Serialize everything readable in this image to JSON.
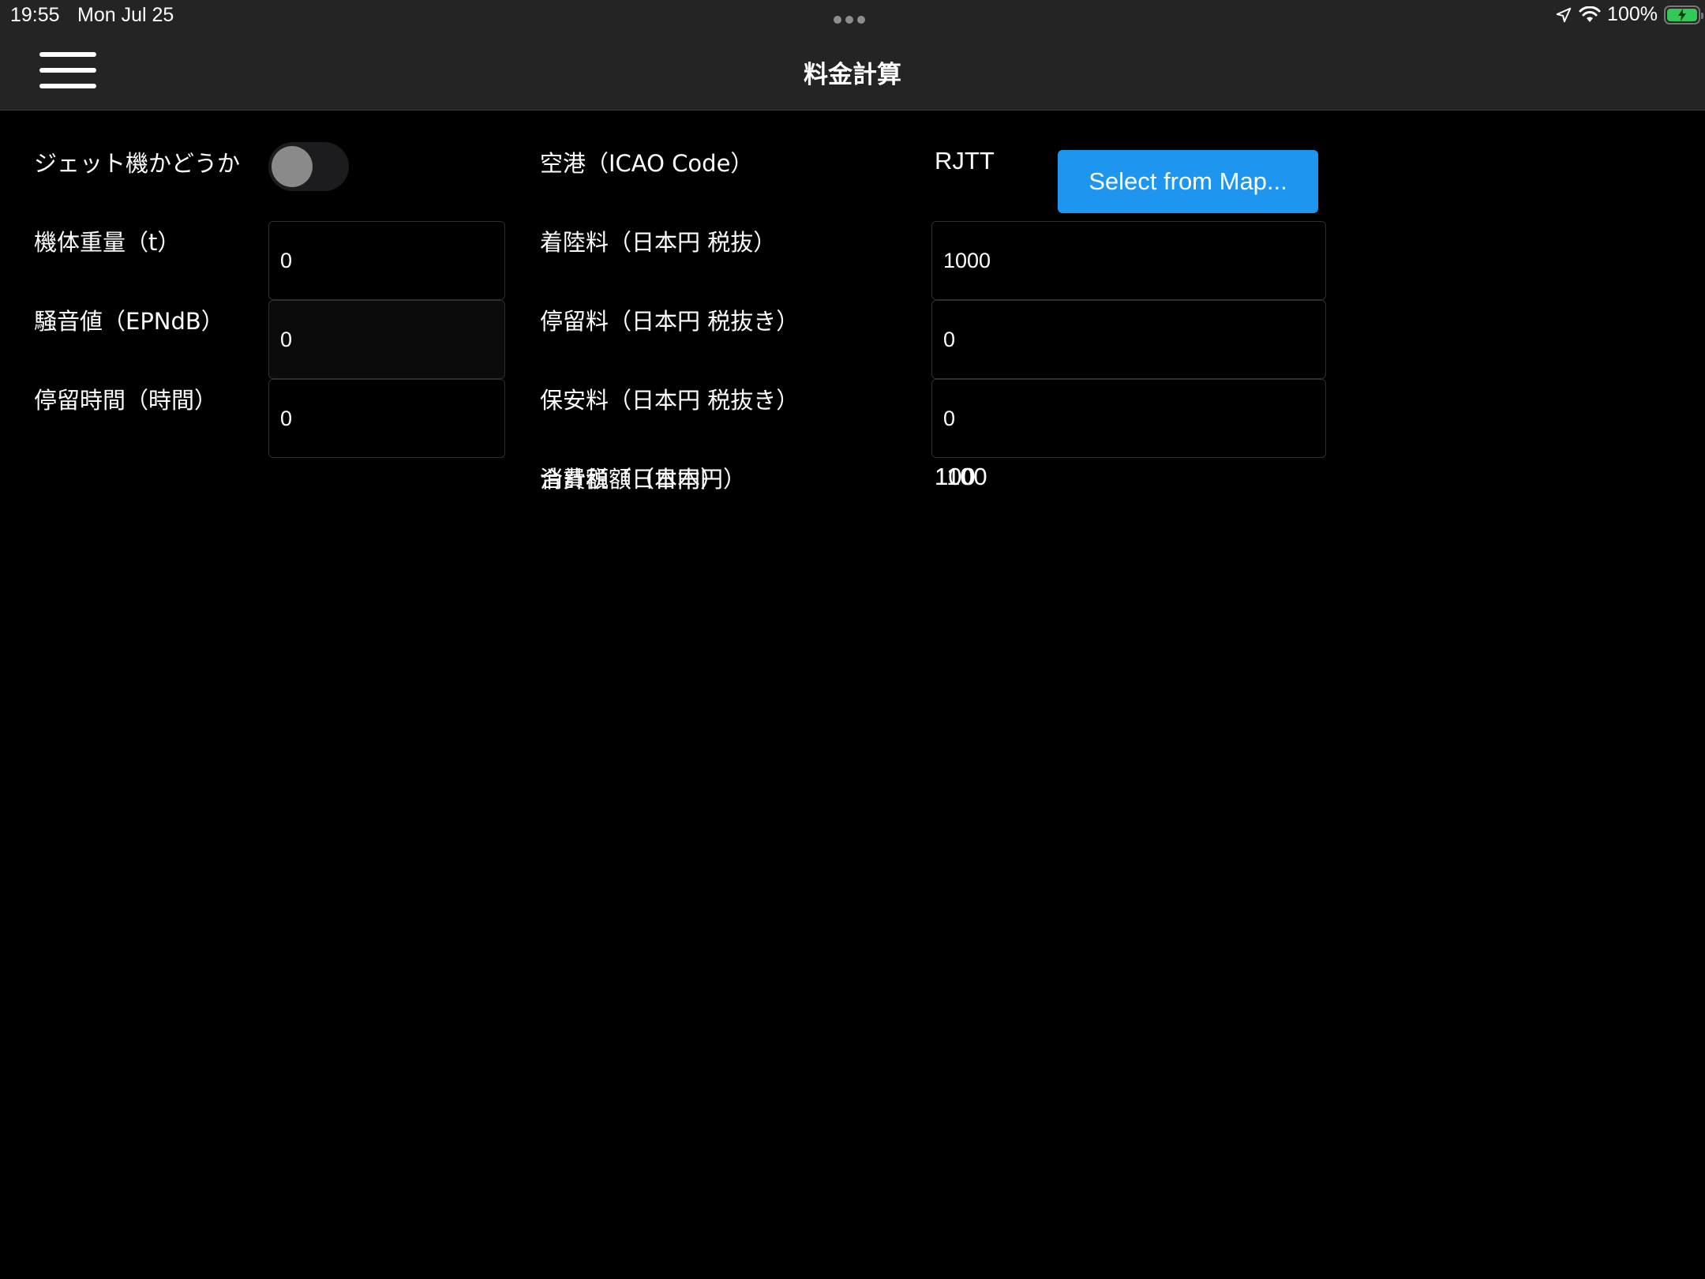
{
  "status_bar": {
    "time": "19:55",
    "date": "Mon Jul 25",
    "battery": "100%"
  },
  "nav": {
    "title": "料金計算"
  },
  "left": {
    "jet_label": "ジェット機かどうか",
    "jet_toggle_on": false,
    "weight_label": "機体重量（t）",
    "weight_value": "0",
    "noise_label": "騒音値（EPNdB）",
    "noise_value": "0",
    "stay_hours_label": "停留時間（時間）",
    "stay_hours_value": "0"
  },
  "right": {
    "airport_label": "空港（ICAO Code）",
    "airport_value": "RJTT",
    "map_button": "Select from Map...",
    "landing_fee_label": "着陸料（日本円 税抜）",
    "landing_fee_value": "1000",
    "parking_fee_label": "停留料（日本円 税抜き）",
    "parking_fee_value": "0",
    "security_fee_label": "保安料（日本円 税抜き）",
    "security_fee_value": "0",
    "consumption_tax_label": "消費税額（日本円）",
    "consumption_tax_value": "100",
    "total_label": "合計額（日本円）",
    "total_value": "1100"
  },
  "colors": {
    "background": "#000000",
    "bar": "#242424",
    "accent": "#1e96f0",
    "battery": "#34c759"
  }
}
